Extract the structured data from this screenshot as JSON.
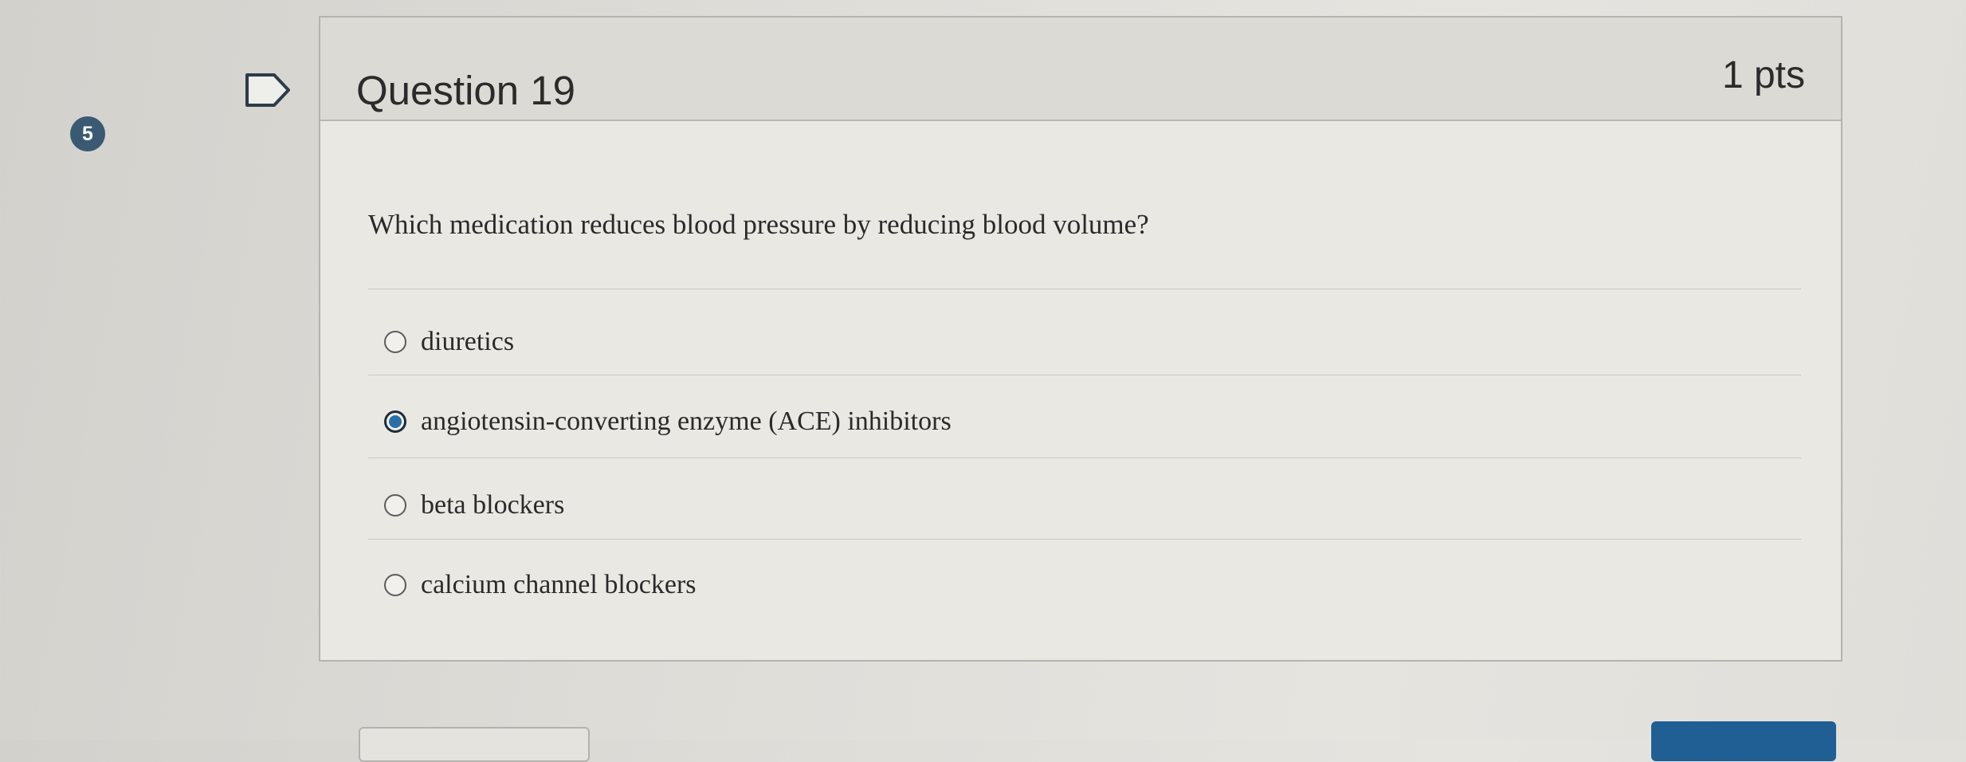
{
  "question_badge": "5",
  "question": {
    "title": "Question 19",
    "points": "1 pts",
    "text": "Which medication reduces blood pressure by reducing blood volume?",
    "answers": [
      {
        "label": "diuretics",
        "selected": false
      },
      {
        "label": "angiotensin-converting enzyme (ACE) inhibitors",
        "selected": true
      },
      {
        "label": "beta blockers",
        "selected": false
      },
      {
        "label": "calcium channel blockers",
        "selected": false
      }
    ]
  },
  "icons": {
    "flag": "flag-icon",
    "radio": "radio-icon"
  },
  "colors": {
    "badge": "#395a72",
    "selected_radio": "#2b6fa8",
    "next_button": "#1f5f93"
  }
}
